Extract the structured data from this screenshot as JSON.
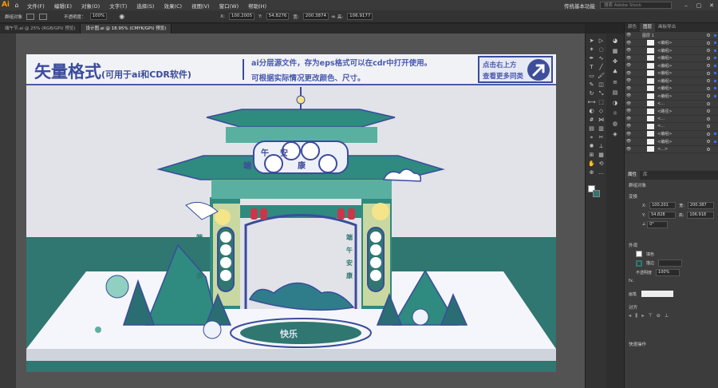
{
  "app": {
    "logo": "Ai"
  },
  "menu": [
    "文件(F)",
    "编辑(E)",
    "对象(O)",
    "文字(T)",
    "选择(S)",
    "效果(C)",
    "视图(V)",
    "窗口(W)",
    "帮助(H)"
  ],
  "workspace": "传统基本功能",
  "search_placeholder": "搜索 Adobe Stock",
  "control_bar": {
    "selection": "群组对象",
    "opacity_label": "不透明度：",
    "opacity_value": "100%",
    "x": "100.2005",
    "y": "54.8276",
    "w": "200.3874",
    "h": "106.9177"
  },
  "tabs": [
    {
      "label": "端午节.ai @ 25% (RGB/GPU 预览)"
    },
    {
      "label": "设计图.ai @ 18.95% (CMYK/GPU 预览)"
    }
  ],
  "banner": {
    "title": "矢量格式",
    "title_sub": "(可用于ai和CDR软件)",
    "line1": "ai分层源文件，存为eps格式可以在cdr中打开使用。",
    "line2": "可根据实际情况更改颜色、尺寸。",
    "button_line1": "点击右上方",
    "button_line2": "查看更多同类"
  },
  "art": {
    "plaque": [
      "端",
      "午",
      "安",
      "康"
    ],
    "left_banner": [
      "端",
      "午",
      "安",
      "康"
    ],
    "right_banner": [
      "端",
      "午",
      "安",
      "康"
    ],
    "stage_text": "快乐"
  },
  "panel": {
    "tabs": [
      "颜色",
      "图层",
      "画板导出"
    ],
    "layers": [
      "图层 1",
      "<编组>",
      "<编组>",
      "<编组>",
      "<编组>",
      "<编组>",
      "<编组>",
      "<编组>",
      "<编组>",
      "<...",
      "<路径>",
      "<...",
      "<...",
      "<编组>",
      "<编组>",
      "<...>"
    ],
    "props_tabs": [
      "属性",
      "库"
    ],
    "group_label": "群组对象",
    "transform_label": "变换",
    "x": "100.201",
    "y": "54.828",
    "w": "200.387",
    "h": "106.918",
    "angle": "0°",
    "appearance_label": "外观",
    "fill_label": "填色",
    "stroke_label": "描边",
    "opacity_label": "不透明度",
    "opacity_value": "100%",
    "fx_label": "fx.",
    "style_label": "画笔",
    "align_label": "对齐",
    "quick_label": "快速操作"
  },
  "colors": {
    "accent": "#3b4c9c",
    "teal": "#2f7d78",
    "artboard": "#e2e3e8"
  }
}
